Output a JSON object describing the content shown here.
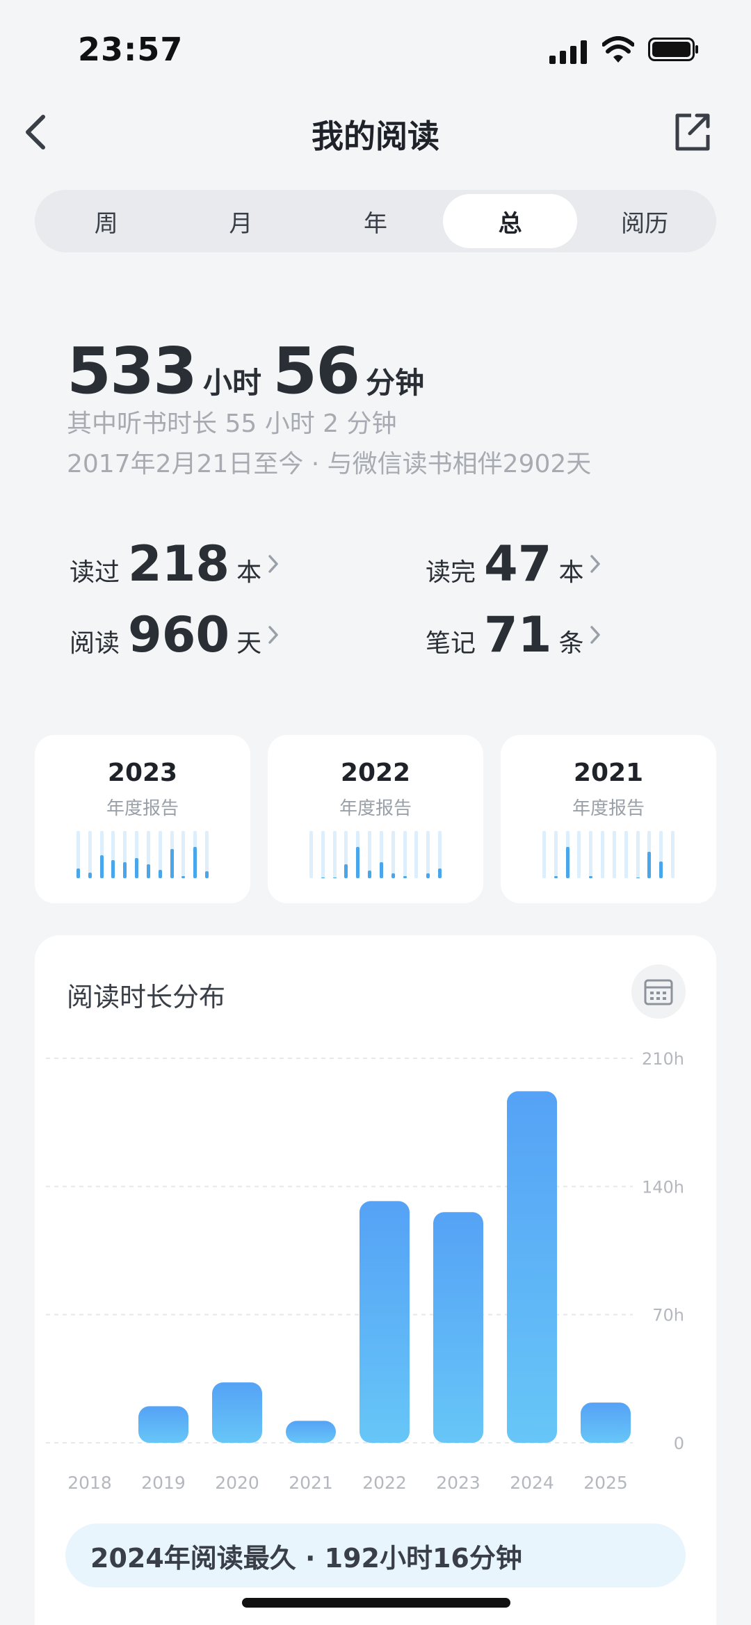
{
  "status": {
    "time": "23:57"
  },
  "nav": {
    "title": "我的阅读"
  },
  "tabs": [
    {
      "label": "周",
      "active": false
    },
    {
      "label": "月",
      "active": false
    },
    {
      "label": "年",
      "active": false
    },
    {
      "label": "总",
      "active": true
    },
    {
      "label": "阅历",
      "active": false
    }
  ],
  "total": {
    "hours": "533",
    "hours_unit": "小时",
    "minutes": "56",
    "minutes_unit": "分钟",
    "listen_line": "其中听书时长 55 小时 2 分钟",
    "since_line": "2017年2月21日至今 · 与微信读书相伴2902天"
  },
  "stats": {
    "read": {
      "label": "读过",
      "value": "218",
      "unit": "本"
    },
    "finished": {
      "label": "读完",
      "value": "47",
      "unit": "本"
    },
    "days": {
      "label": "阅读",
      "value": "960",
      "unit": "天"
    },
    "notes": {
      "label": "笔记",
      "value": "71",
      "unit": "条"
    }
  },
  "reports": [
    {
      "year": "2023",
      "label": "年度报告",
      "bars": [
        0.2,
        0.12,
        0.48,
        0.38,
        0.34,
        0.42,
        0.3,
        0.18,
        0.62,
        0.04,
        0.66,
        0.14
      ]
    },
    {
      "year": "2022",
      "label": "年度报告",
      "bars": [
        0.0,
        0.02,
        0.02,
        0.3,
        0.66,
        0.16,
        0.34,
        0.1,
        0.04,
        0.0,
        0.1,
        0.2
      ]
    },
    {
      "year": "2021",
      "label": "年度报告",
      "bars": [
        0.0,
        0.04,
        0.66,
        0.0,
        0.04,
        0.0,
        0.0,
        0.0,
        0.02,
        0.56,
        0.36,
        0.0
      ]
    }
  ],
  "chart": {
    "title": "阅读时长分布",
    "summary": "2024年阅读最久 · 192小时16分钟",
    "accent": "#4f9ef5"
  },
  "chart_data": {
    "type": "bar",
    "categories": [
      "2018",
      "2019",
      "2020",
      "2021",
      "2022",
      "2023",
      "2024",
      "2025"
    ],
    "values": [
      0,
      20,
      33,
      12,
      132,
      126,
      192,
      22
    ],
    "ylim": [
      0,
      210
    ],
    "yticks": [
      0,
      70,
      140,
      210
    ],
    "ytick_labels": [
      "0",
      "70h",
      "140h",
      "210h"
    ],
    "grid": true
  }
}
